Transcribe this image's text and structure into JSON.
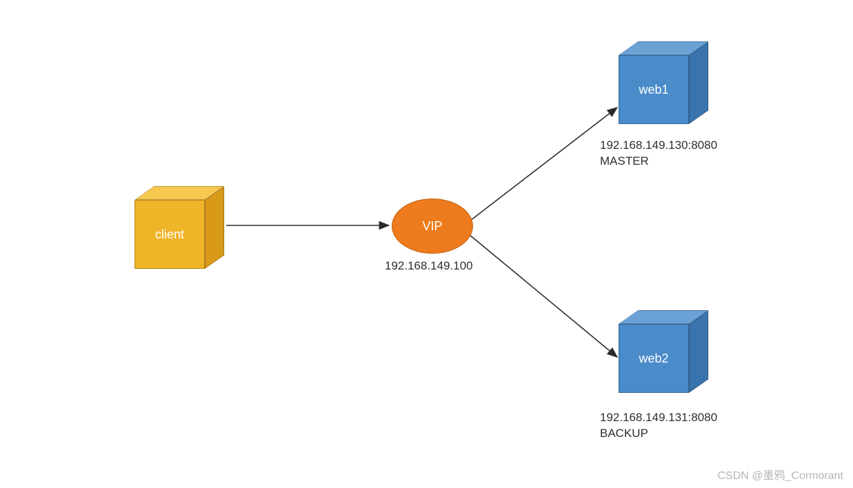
{
  "client": {
    "label": "client"
  },
  "vip": {
    "label": "VIP",
    "ip": "192.168.149.100"
  },
  "web1": {
    "label": "web1",
    "sub": "192.168.149.130:8080\nMASTER"
  },
  "web2": {
    "label": "web2",
    "sub": "192.168.149.131:8080\nBACKUP"
  },
  "watermark": "CSDN @墨鸦_Cormorant"
}
